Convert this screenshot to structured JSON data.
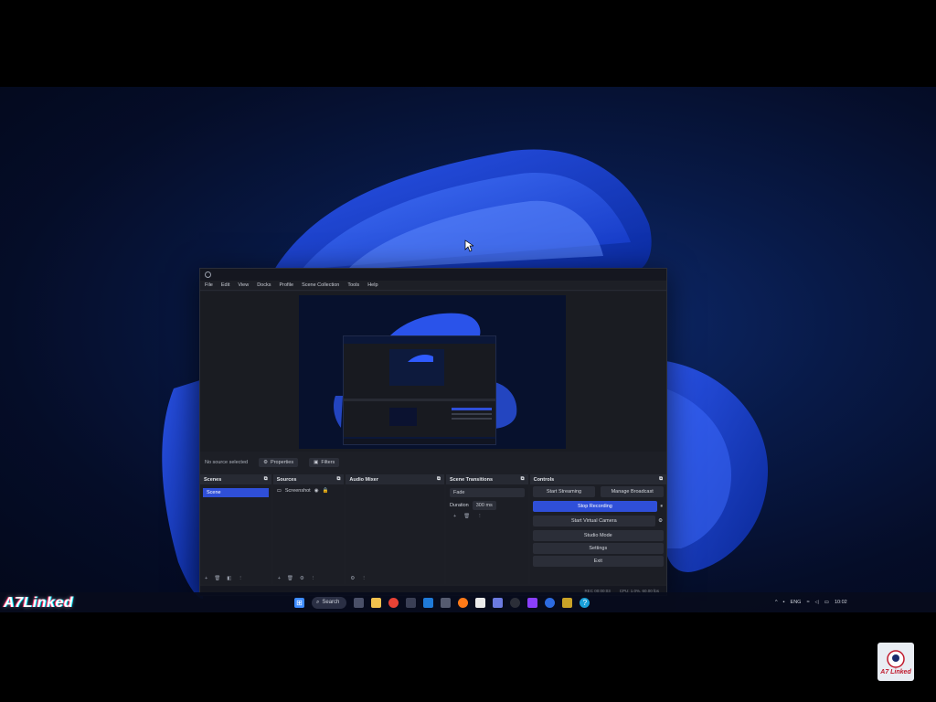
{
  "obs": {
    "menu": [
      "File",
      "Edit",
      "View",
      "Docks",
      "Profile",
      "Scene Collection",
      "Tools",
      "Help"
    ],
    "source_bar": {
      "no_source": "No source selected",
      "properties": "Properties",
      "filters": "Filters"
    },
    "scenes": {
      "title": "Scenes",
      "items": [
        "Scene"
      ]
    },
    "sources": {
      "title": "Sources",
      "items": [
        "Screenshot"
      ]
    },
    "audio_mixer": {
      "title": "Audio Mixer"
    },
    "transitions": {
      "title": "Scene Transitions",
      "type": "Fade",
      "duration_label": "Duration",
      "duration_value": "300 ms"
    },
    "controls": {
      "title": "Controls",
      "start_streaming": "Start Streaming",
      "manage_broadcast": "Manage Broadcast",
      "stop_recording": "Stop Recording",
      "start_virtual_camera": "Start Virtual Camera",
      "studio_mode": "Studio Mode",
      "settings": "Settings",
      "exit": "Exit"
    },
    "status": {
      "rec": "REC 00:00:03",
      "cpu": "CPU: 1.0%, 60.00 fps"
    }
  },
  "taskbar": {
    "search_label": "Search",
    "lang": "ENG",
    "time": "10:02"
  },
  "brand": {
    "label": "A7Linked",
    "badge": "A7 Linked"
  },
  "colors": {
    "accent": "#2f4fd8",
    "desktop": "#081a48",
    "panel": "#1c1e25"
  }
}
